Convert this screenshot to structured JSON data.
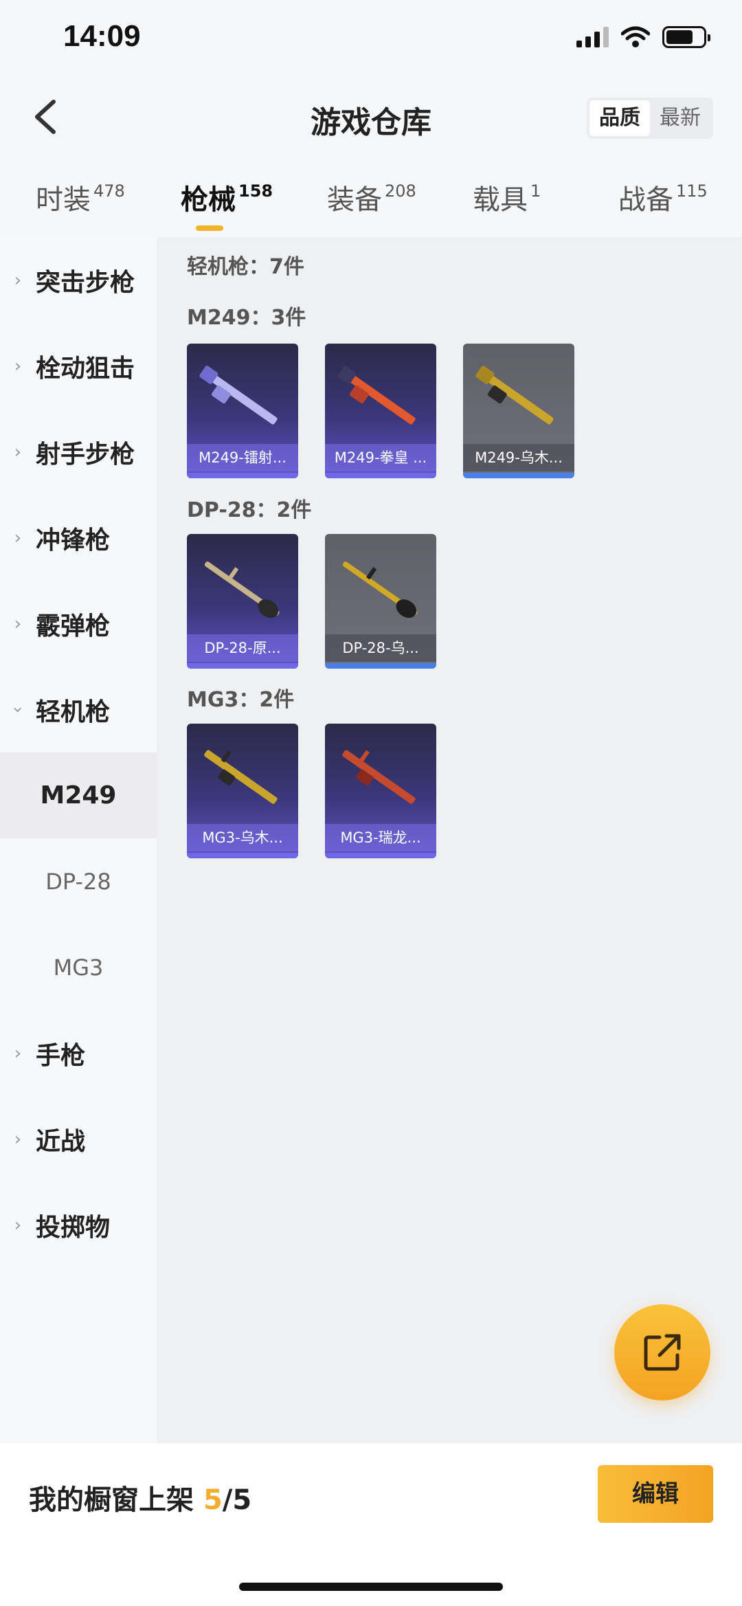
{
  "status": {
    "time": "14:09"
  },
  "header": {
    "title": "游戏仓库",
    "sort": {
      "quality": "品质",
      "newest": "最新"
    }
  },
  "tabs": [
    {
      "label": "时装",
      "count": "478"
    },
    {
      "label": "枪械",
      "count": "158"
    },
    {
      "label": "装备",
      "count": "208"
    },
    {
      "label": "载具",
      "count": "1"
    },
    {
      "label": "战备",
      "count": "115"
    }
  ],
  "sidebar": {
    "categories": [
      "突击步枪",
      "栓动狙击",
      "射手步枪",
      "冲锋枪",
      "霰弹枪",
      "轻机枪"
    ],
    "subitems": [
      "M249",
      "DP-28",
      "MG3"
    ],
    "more": [
      "手枪",
      "近战",
      "投掷物"
    ]
  },
  "content": {
    "summary": "轻机枪：7件",
    "groups": [
      {
        "title": "M249：3件",
        "items": [
          "M249-镭射...",
          "M249-拳皇 ...",
          "M249-乌木..."
        ]
      },
      {
        "title": "DP-28：2件",
        "items": [
          "DP-28-原...",
          "DP-28-乌..."
        ]
      },
      {
        "title": "MG3：2件",
        "items": [
          "MG3-乌木...",
          "MG3-瑞龙..."
        ]
      }
    ]
  },
  "bottom": {
    "prefix": "我的橱窗上架 ",
    "current": "5",
    "total": "/5",
    "edit": "编辑"
  },
  "colors": {
    "accent": "#f4ad2b",
    "purple_card": "#5e54c7",
    "grey_card": "#6f7079"
  }
}
